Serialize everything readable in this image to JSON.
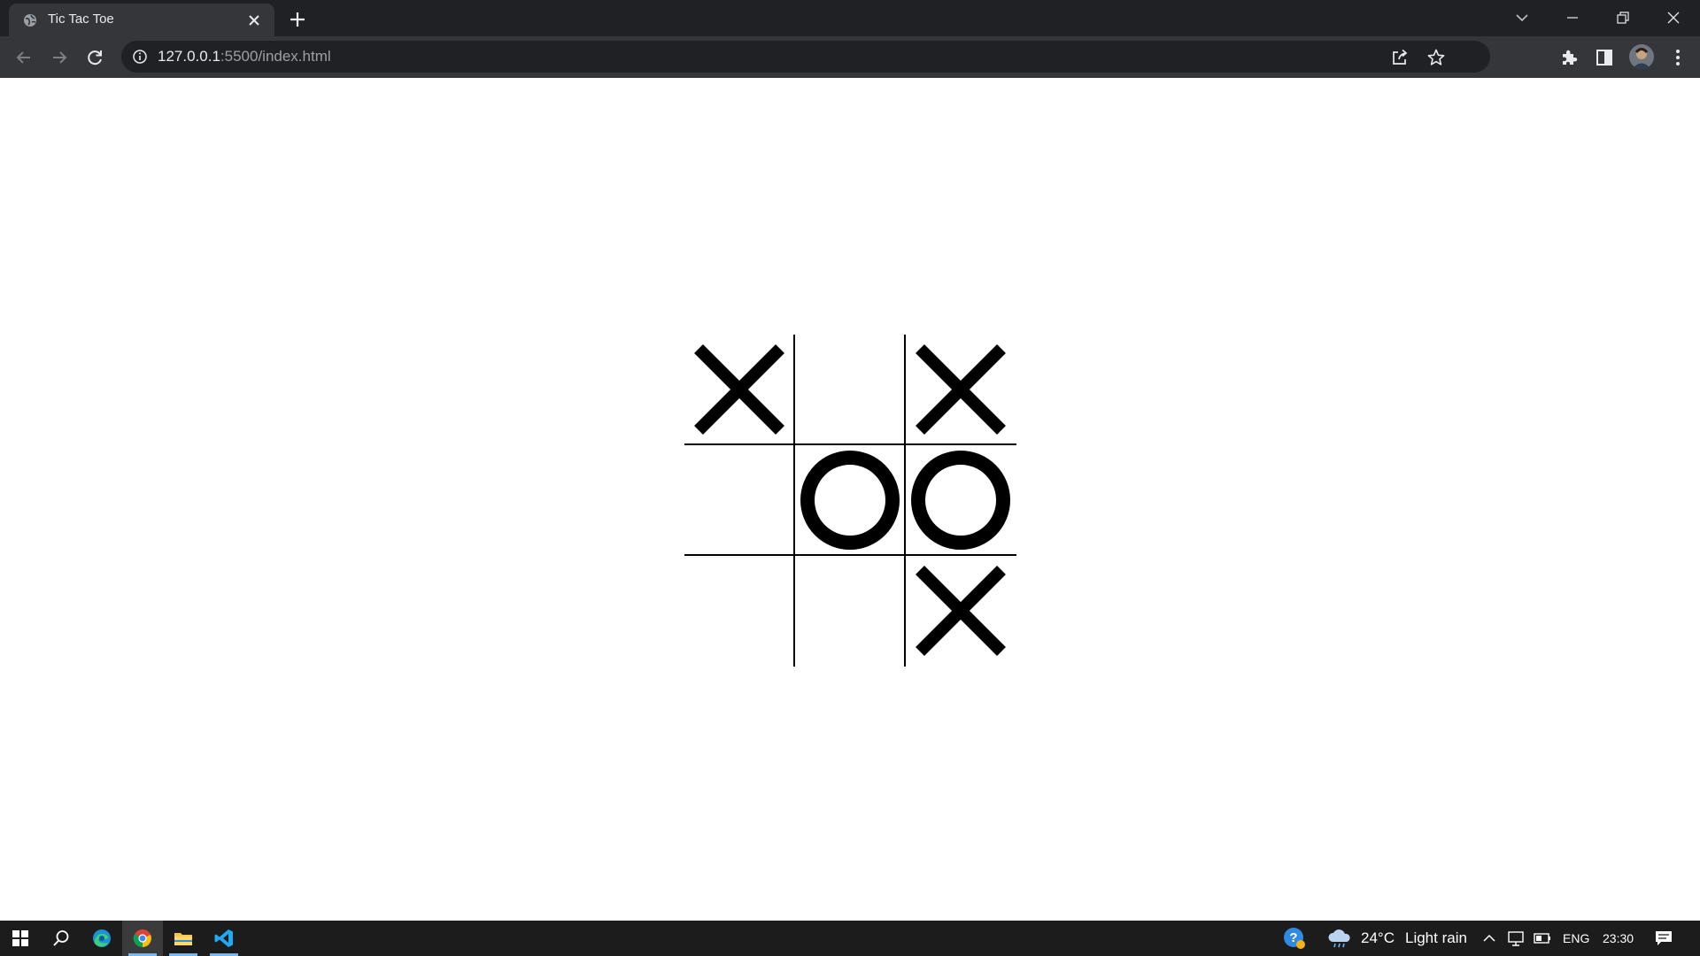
{
  "browser": {
    "tab_title": "Tic Tac Toe",
    "url_host": "127.0.0.1",
    "url_path": ":5500/index.html"
  },
  "game": {
    "board": [
      [
        "X",
        "",
        "X"
      ],
      [
        "",
        "O",
        "O"
      ],
      [
        "",
        "",
        "X"
      ]
    ],
    "mark_color": "#000000"
  },
  "taskbar": {
    "weather_temp": "24°C",
    "weather_desc": "Light rain",
    "language": "ENG",
    "time": "23:30",
    "accent_color": "#76b9ed"
  }
}
